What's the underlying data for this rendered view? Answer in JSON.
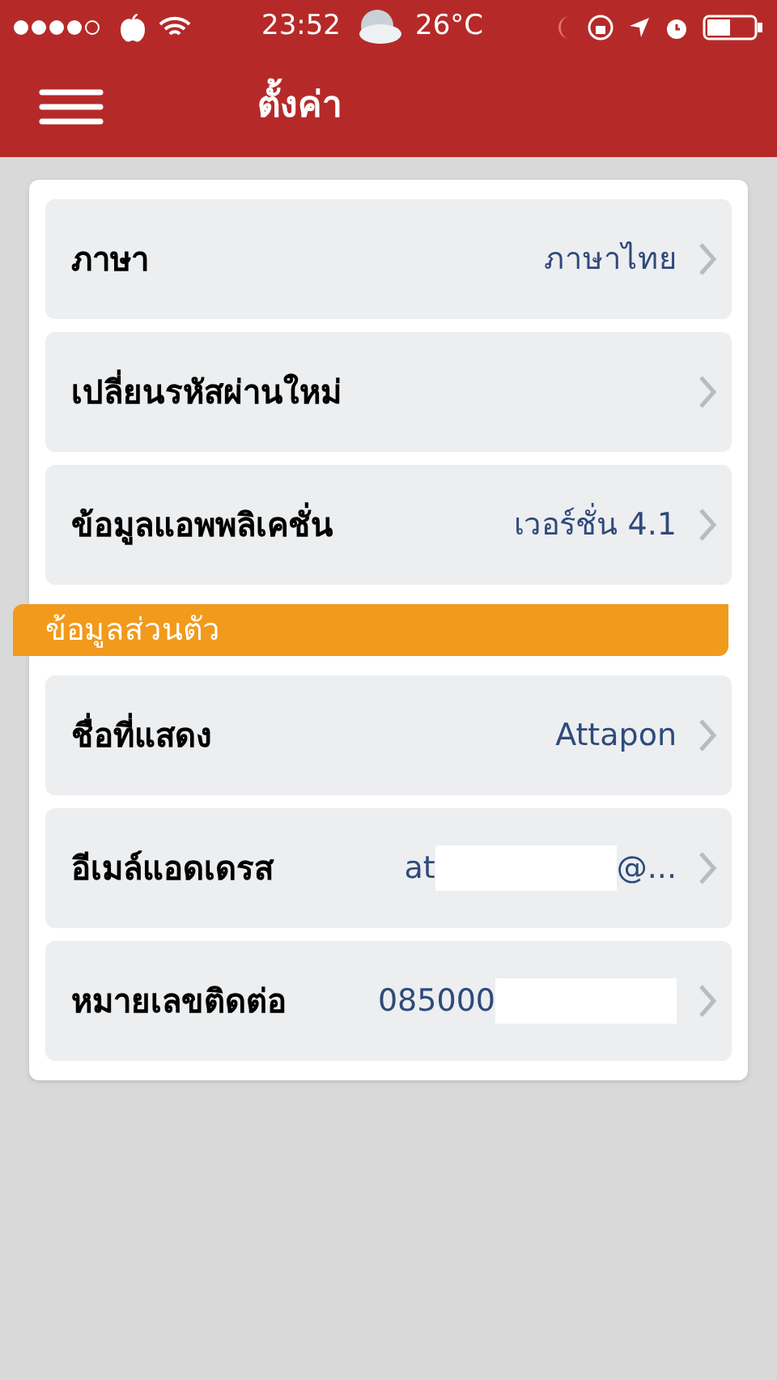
{
  "status_bar": {
    "time": "23:52",
    "temperature": "26°C"
  },
  "header": {
    "title": "ตั้งค่า"
  },
  "settings": [
    {
      "label": "ภาษา",
      "value_parts": [
        "ภาษาไทย"
      ],
      "redacted": false
    },
    {
      "label": "เปลี่ยนรหัสผ่านใหม่",
      "redacted": false
    },
    {
      "label": "ข้อมูลแอพพลิเคชั่น",
      "value_parts": [
        "เวอร์ชั่น 4.1"
      ],
      "redacted": false
    }
  ],
  "section": {
    "title": "ข้อมูลส่วนตัว"
  },
  "personal": [
    {
      "label": "ชื่อที่แสดง",
      "value_parts": [
        "Attapon"
      ],
      "redacted": false
    },
    {
      "label": "อีเมล์แอดเดรส",
      "value_parts": [
        "at",
        "@..."
      ],
      "redacted": true
    },
    {
      "label": "หมายเลขติดต่อ",
      "value_parts": [
        "085000"
      ],
      "redacted": true
    }
  ]
}
